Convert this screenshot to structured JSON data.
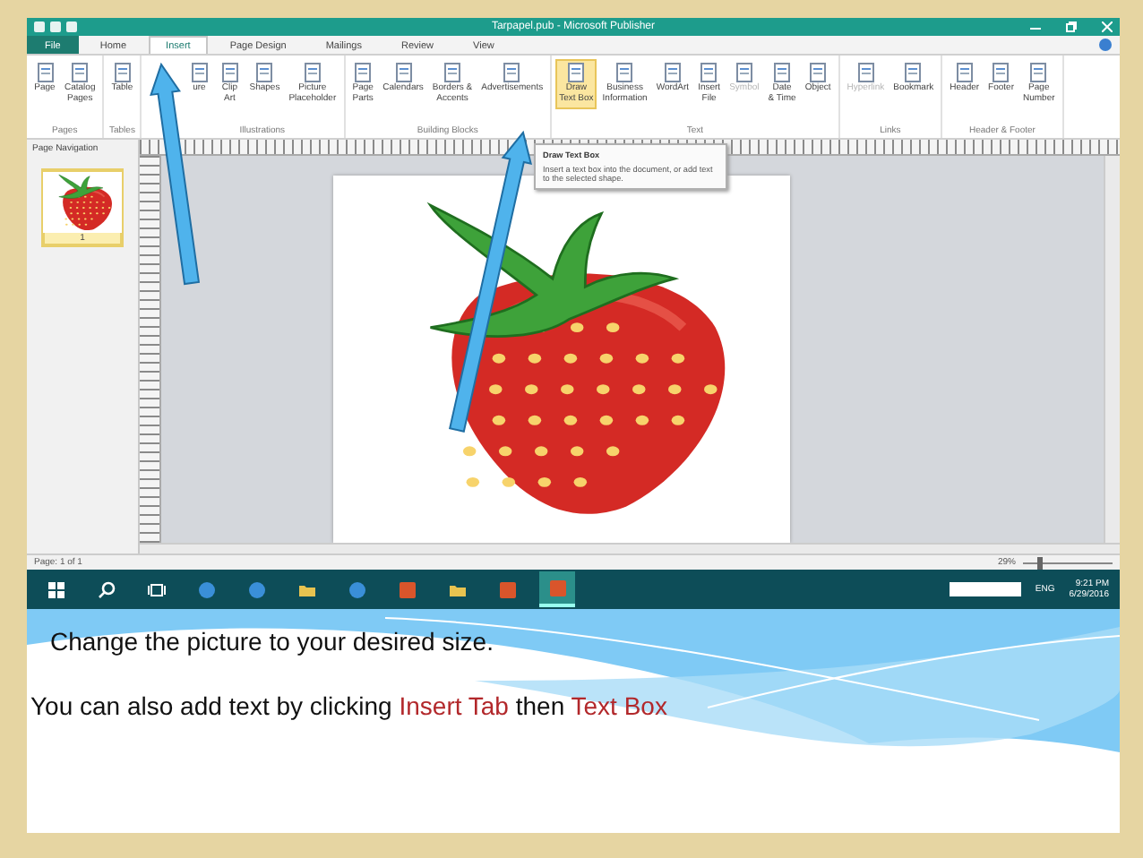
{
  "window": {
    "title": "Tarpapel.pub - Microsoft Publisher"
  },
  "tabs": [
    {
      "label": "File",
      "kind": "file",
      "selected": false
    },
    {
      "label": "Home",
      "kind": "tab",
      "selected": false
    },
    {
      "label": "Insert",
      "kind": "tab",
      "selected": true
    },
    {
      "label": "Page Design",
      "kind": "tab",
      "selected": false
    },
    {
      "label": "Mailings",
      "kind": "tab",
      "selected": false
    },
    {
      "label": "Review",
      "kind": "tab",
      "selected": false
    },
    {
      "label": "View",
      "kind": "tab",
      "selected": false
    }
  ],
  "ribbon": {
    "groups": [
      {
        "name": "Pages",
        "buttons": [
          {
            "label": "Page",
            "disabled": false,
            "selected": false
          },
          {
            "label": "Catalog\nPages",
            "disabled": false,
            "selected": false
          }
        ]
      },
      {
        "name": "Tables",
        "buttons": [
          {
            "label": "Table",
            "disabled": false,
            "selected": false
          }
        ]
      },
      {
        "name": "Illustrations",
        "buttons": [
          {
            "label": "ure",
            "disabled": false,
            "selected": false
          },
          {
            "label": "Clip\nArt",
            "disabled": false,
            "selected": false
          },
          {
            "label": "Shapes",
            "disabled": false,
            "selected": false
          },
          {
            "label": "Picture\nPlaceholder",
            "disabled": false,
            "selected": false
          }
        ]
      },
      {
        "name": "Building Blocks",
        "buttons": [
          {
            "label": "Page\nParts",
            "disabled": false,
            "selected": false
          },
          {
            "label": "Calendars",
            "disabled": false,
            "selected": false
          },
          {
            "label": "Borders &\nAccents",
            "disabled": false,
            "selected": false
          },
          {
            "label": "Advertisements",
            "disabled": false,
            "selected": false
          }
        ]
      },
      {
        "name": "Text",
        "buttons": [
          {
            "label": "Draw\nText Box",
            "disabled": false,
            "selected": true
          },
          {
            "label": "Business\nInformation",
            "disabled": false,
            "selected": false
          },
          {
            "label": "WordArt",
            "disabled": false,
            "selected": false
          },
          {
            "label": "Insert\nFile",
            "disabled": false,
            "selected": false
          },
          {
            "label": "Symbol",
            "disabled": true,
            "selected": false
          },
          {
            "label": "Date\n& Time",
            "disabled": false,
            "selected": false
          },
          {
            "label": "Object",
            "disabled": false,
            "selected": false
          }
        ]
      },
      {
        "name": "Links",
        "buttons": [
          {
            "label": "Hyperlink",
            "disabled": true,
            "selected": false
          },
          {
            "label": "Bookmark",
            "disabled": false,
            "selected": false
          }
        ]
      },
      {
        "name": "Header & Footer",
        "buttons": [
          {
            "label": "Header",
            "disabled": false,
            "selected": false
          },
          {
            "label": "Footer",
            "disabled": false,
            "selected": false
          },
          {
            "label": "Page\nNumber",
            "disabled": false,
            "selected": false
          }
        ]
      }
    ]
  },
  "tooltip": {
    "title": "Draw Text Box",
    "body": "Insert a text box into the document, or add text to the selected shape."
  },
  "page_navigation": {
    "title": "Page Navigation",
    "pages": [
      {
        "number": "1",
        "selected": true
      }
    ]
  },
  "status_bar": {
    "page": "Page: 1 of 1",
    "zoom": "29%",
    "zoom_slider": {
      "level": 0.15
    }
  },
  "taskbar": {
    "apps": [
      {
        "kind": "start",
        "selected": false
      },
      {
        "kind": "search",
        "selected": false
      },
      {
        "kind": "task-view",
        "selected": false
      },
      {
        "kind": "browser",
        "selected": false
      },
      {
        "kind": "browser",
        "selected": false
      },
      {
        "kind": "folder",
        "selected": false
      },
      {
        "kind": "browser",
        "selected": false
      },
      {
        "kind": "tile",
        "selected": false
      },
      {
        "kind": "folder",
        "selected": false
      },
      {
        "kind": "tile",
        "selected": false
      },
      {
        "kind": "tile",
        "selected": true
      }
    ],
    "language": "ENG",
    "time": "9:21 PM",
    "date": "6/29/2016"
  },
  "slide": {
    "caption": "Change the picture to your desired size.",
    "instruction": [
      {
        "text": "You can also add text by clicking ",
        "kind": "plain"
      },
      {
        "text": "Insert Tab",
        "kind": "highlight"
      },
      {
        "text": " then ",
        "kind": "plain"
      },
      {
        "text": "Text Box",
        "kind": "highlight"
      }
    ]
  }
}
